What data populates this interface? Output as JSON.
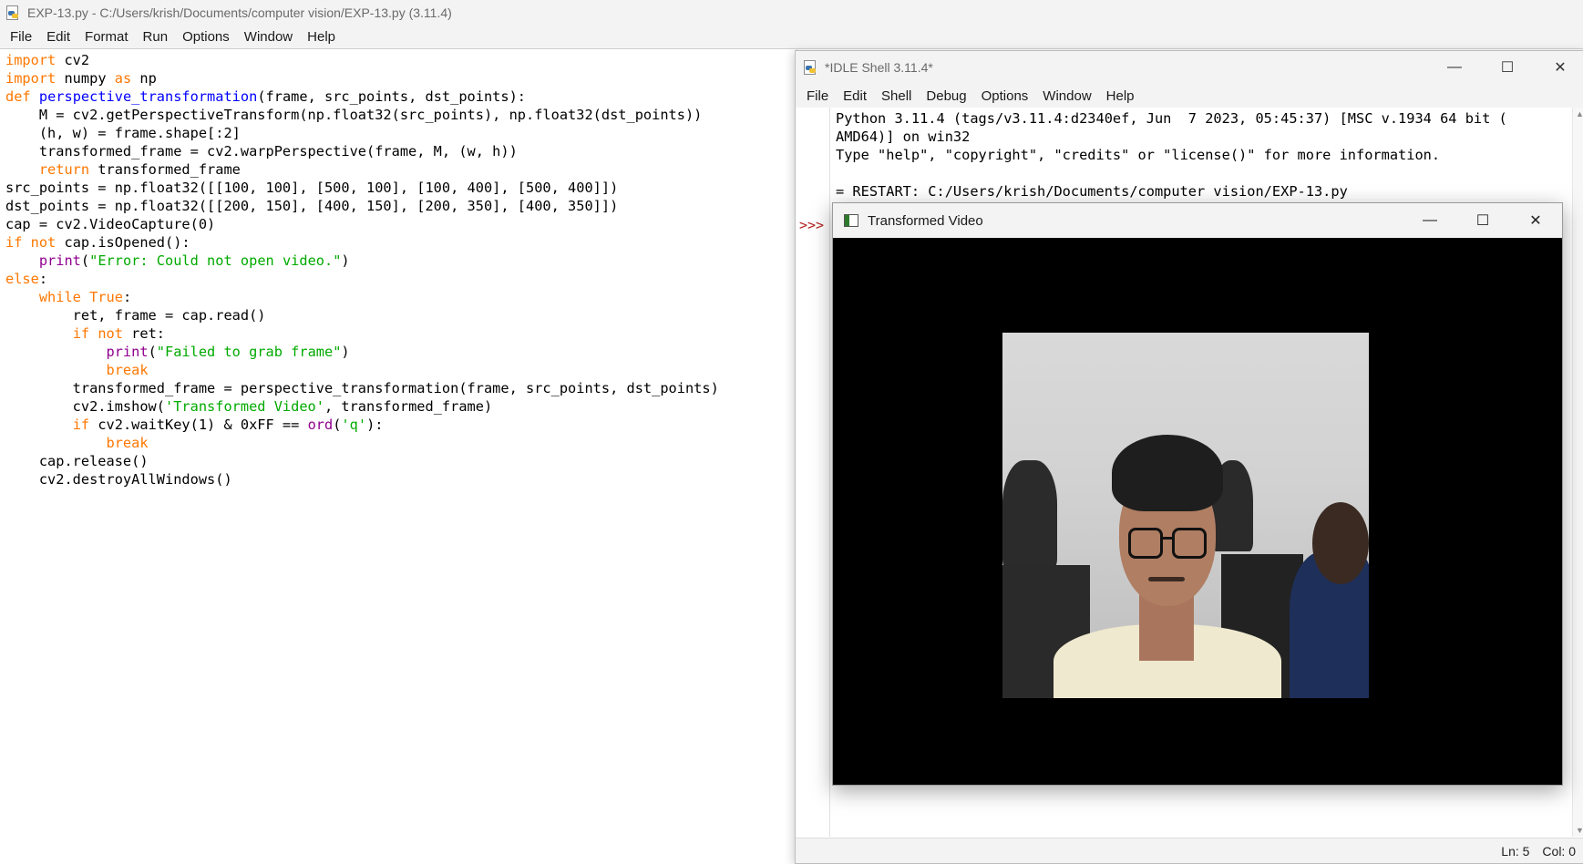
{
  "editor": {
    "title": "EXP-13.py - C:/Users/krish/Documents/computer vision/EXP-13.py (3.11.4)",
    "menu": [
      "File",
      "Edit",
      "Format",
      "Run",
      "Options",
      "Window",
      "Help"
    ],
    "code_lines": [
      "import cv2",
      "import numpy as np",
      "def perspective_transformation(frame, src_points, dst_points):",
      "    M = cv2.getPerspectiveTransform(np.float32(src_points), np.float32(dst_points))",
      "    (h, w) = frame.shape[:2]",
      "    transformed_frame = cv2.warpPerspective(frame, M, (w, h))",
      "    return transformed_frame",
      "src_points = np.float32([[100, 100], [500, 100], [100, 400], [500, 400]])",
      "dst_points = np.float32([[200, 150], [400, 150], [200, 350], [400, 350]])",
      "cap = cv2.VideoCapture(0)",
      "if not cap.isOpened():",
      "    print(\"Error: Could not open video.\")",
      "else:",
      "    while True:",
      "        ret, frame = cap.read()",
      "        if not ret:",
      "            print(\"Failed to grab frame\")",
      "            break",
      "        transformed_frame = perspective_transformation(frame, src_points, dst_points)",
      "        cv2.imshow('Transformed Video', transformed_frame)",
      "        if cv2.waitKey(1) & 0xFF == ord('q'):",
      "            break",
      "    cap.release()",
      "    cv2.destroyAllWindows()"
    ]
  },
  "shell": {
    "title": "*IDLE Shell 3.11.4*",
    "menu": [
      "File",
      "Edit",
      "Shell",
      "Debug",
      "Options",
      "Window",
      "Help"
    ],
    "prompt": ">>>",
    "lines": [
      "Python 3.11.4 (tags/v3.11.4:d2340ef, Jun  7 2023, 05:45:37) [MSC v.1934 64 bit (",
      "AMD64)] on win32",
      "Type \"help\", \"copyright\", \"credits\" or \"license()\" for more information.",
      "",
      "= RESTART: C:/Users/krish/Documents/computer vision/EXP-13.py"
    ],
    "status": {
      "line": "Ln: 5",
      "col": "Col: 0"
    }
  },
  "video_window": {
    "title": "Transformed Video"
  },
  "colors": {
    "keyword": "#ff7700",
    "builtin": "#900090",
    "string": "#00aa00",
    "definition": "#0000ff",
    "prompt": "#b22222"
  },
  "icons": [
    "python-file-icon",
    "minimize-icon",
    "maximize-icon",
    "close-icon",
    "opencv-window-icon"
  ]
}
